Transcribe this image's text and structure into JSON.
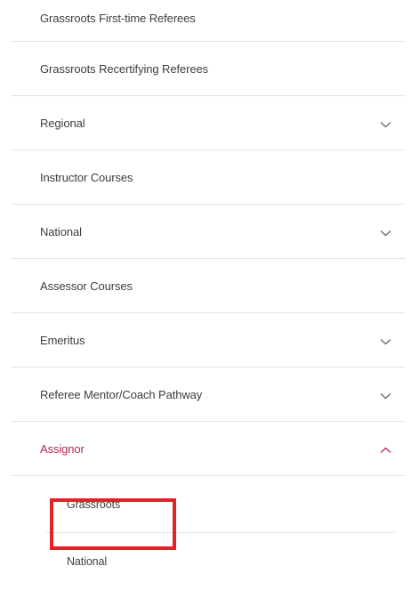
{
  "menu": {
    "items": [
      {
        "label": "Grassroots First-time Referees",
        "expandable": false
      },
      {
        "label": "Grassroots Recertifying Referees",
        "expandable": false
      },
      {
        "label": "Regional",
        "expandable": true,
        "expanded": false
      },
      {
        "label": "Instructor Courses",
        "expandable": false
      },
      {
        "label": "National",
        "expandable": true,
        "expanded": false
      },
      {
        "label": "Assessor Courses",
        "expandable": false
      },
      {
        "label": "Emeritus",
        "expandable": true,
        "expanded": false
      },
      {
        "label": "Referee Mentor/Coach Pathway",
        "expandable": true,
        "expanded": false
      },
      {
        "label": "Assignor",
        "expandable": true,
        "expanded": true
      }
    ],
    "submenu": {
      "items": [
        {
          "label": "Grassroots",
          "highlighted": true
        },
        {
          "label": "National",
          "highlighted": false
        }
      ]
    }
  },
  "colors": {
    "text": "#3d3d3d",
    "active": "#b5264f",
    "chevron": "#666666",
    "divider": "#e4e4e4",
    "highlight": "#e32227"
  },
  "icons": {
    "collapsed": "chevron-down-icon",
    "expanded": "chevron-up-icon"
  }
}
